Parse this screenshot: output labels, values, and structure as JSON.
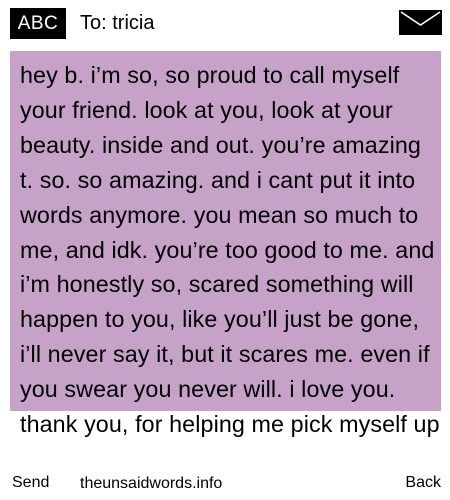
{
  "header": {
    "input_mode": "ABC",
    "recipient": "To: tricia",
    "icon": "envelope-icon"
  },
  "message": {
    "text": "hey b. i’m so, so proud to call myself your friend. look at you, look at your beauty. inside and out. you’re amazing t. so. so amazing. and i cant put it into words anymore. you mean so much to me, and idk. you’re too good to me. and i’m honestly so, scared something will happen to you, like you’ll just be gone, i’ll never say it, but it scares me. even if you swear you never will. i love you. thank you, for helping me pick myself up"
  },
  "softkeys": {
    "left": "Send",
    "right": "Back"
  },
  "watermark": "theunsaidwords.info",
  "colors": {
    "message_background": "#c6a2c8",
    "badge_background": "#000000"
  }
}
